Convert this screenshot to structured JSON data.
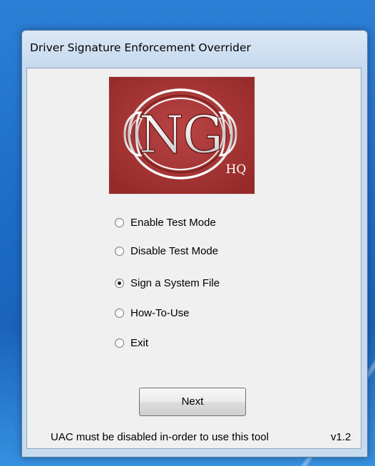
{
  "window": {
    "title": "Driver Signature Enforcement Overrider"
  },
  "logo": {
    "main_text": "NG",
    "sub_text": "HQ"
  },
  "options": [
    {
      "label": "Enable Test Mode",
      "selected": false
    },
    {
      "label": "Disable Test Mode",
      "selected": false
    },
    {
      "label": "Sign a System File",
      "selected": true
    },
    {
      "label": "How-To-Use",
      "selected": false
    },
    {
      "label": "Exit",
      "selected": false
    }
  ],
  "buttons": {
    "next_label": "Next"
  },
  "footer": {
    "note": "UAC must be disabled in-order to use this tool",
    "version": "v1.2"
  },
  "colors": {
    "desktop": "#1c6cc8",
    "window_frame": "#c7dbef",
    "client_bg": "#f0f0f0",
    "logo_bg": "#a83232"
  }
}
